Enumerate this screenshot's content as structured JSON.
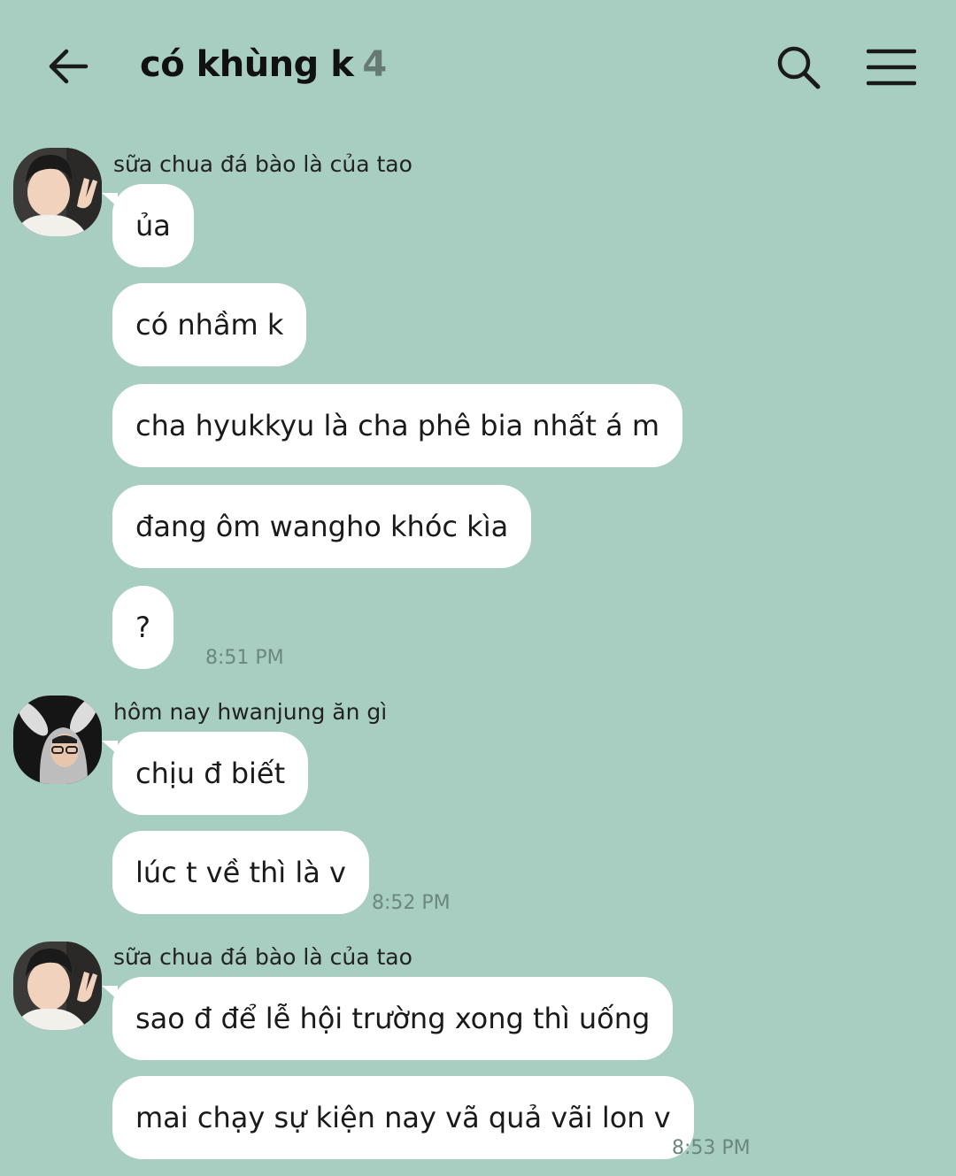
{
  "header": {
    "title": "có khùng k",
    "member_count": "4",
    "back_icon": "arrow-left-icon",
    "search_icon": "search-icon",
    "menu_icon": "hamburger-menu-icon"
  },
  "messages": [
    {
      "sender": "sữa chua đá bào là của tao",
      "bubbles": [
        "ủa",
        "có nhầm k",
        "cha hyukkyu là cha phê bia nhất á m",
        "đang ôm wangho khóc kìa",
        "?"
      ],
      "time": "8:51 PM"
    },
    {
      "sender": "hôm nay hwanjung ăn gì",
      "bubbles": [
        "chịu đ biết",
        "lúc t về thì là v"
      ],
      "time": "8:52 PM"
    },
    {
      "sender": "sữa chua đá bào là của tao",
      "bubbles": [
        "sao đ để lễ hội trường xong thì uống",
        "mai chạy sự kiện nay vã quả vãi lon v"
      ],
      "time": "8:53 PM"
    }
  ],
  "colors": {
    "background": "#a7cec1",
    "bubble": "#ffffff",
    "time": "#6c8780"
  }
}
